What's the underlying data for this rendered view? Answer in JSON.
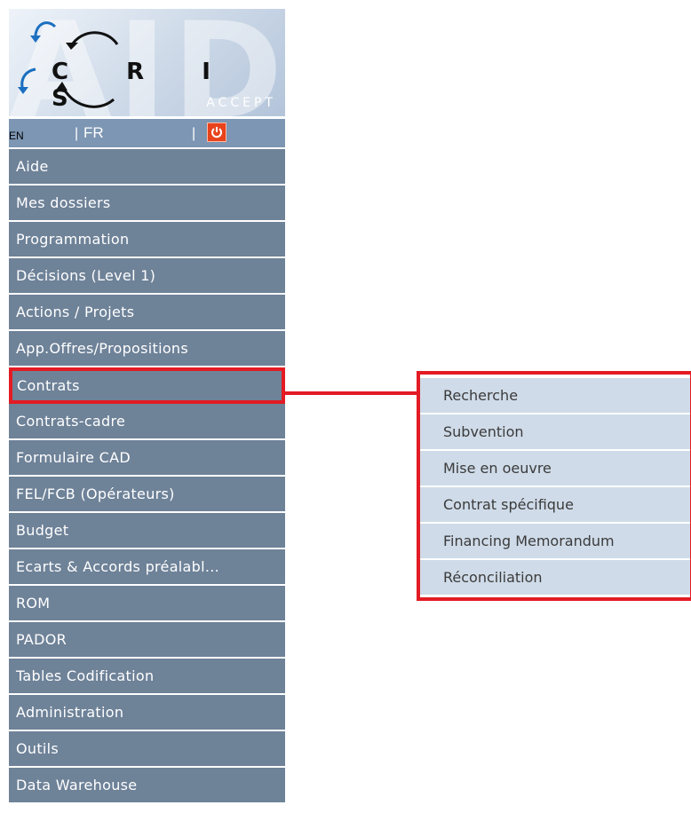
{
  "logo": {
    "text": "C R I S",
    "subtitle": "ACCEPT",
    "watermark": "AID"
  },
  "lang": {
    "en": "EN",
    "fr": "FR",
    "separator": "|",
    "power_icon": "power-icon"
  },
  "menu": {
    "items": [
      {
        "label": "Aide"
      },
      {
        "label": "Mes dossiers"
      },
      {
        "label": "Programmation"
      },
      {
        "label": "Décisions (Level 1)"
      },
      {
        "label": "Actions / Projets"
      },
      {
        "label": "App.Offres/Propositions"
      },
      {
        "label": "Contrats"
      },
      {
        "label": "Contrats-cadre"
      },
      {
        "label": "Formulaire CAD"
      },
      {
        "label": "FEL/FCB (Opérateurs)"
      },
      {
        "label": "Budget"
      },
      {
        "label": "Ecarts & Accords préalabl..."
      },
      {
        "label": "ROM"
      },
      {
        "label": "PADOR"
      },
      {
        "label": "Tables Codification"
      },
      {
        "label": "Administration"
      },
      {
        "label": "Outils"
      },
      {
        "label": "Data Warehouse"
      }
    ]
  },
  "submenu": {
    "items": [
      {
        "label": "Recherche"
      },
      {
        "label": "Subvention"
      },
      {
        "label": "Mise en oeuvre"
      },
      {
        "label": "Contrat spécifique"
      },
      {
        "label": "Financing Memorandum"
      },
      {
        "label": "Réconciliation"
      }
    ]
  },
  "colors": {
    "menu_bg": "#6e8298",
    "submenu_bg": "#cfdbe8",
    "highlight": "#e31b23",
    "lang_bar": "#7c96b3"
  }
}
